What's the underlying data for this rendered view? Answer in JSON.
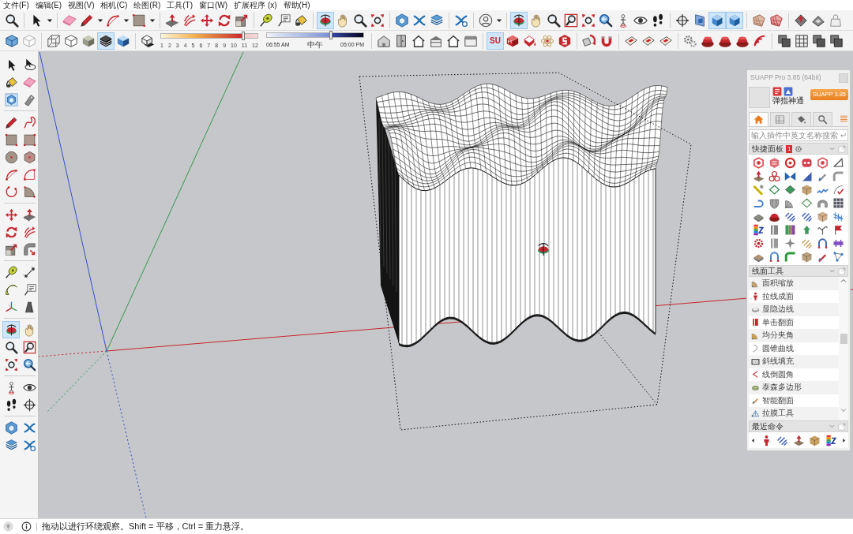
{
  "menu_bar": [
    "文件(F)",
    "编辑(E)",
    "视图(V)",
    "相机(C)",
    "绘图(R)",
    "工具(T)",
    "窗口(W)",
    "扩展程序 (x)",
    "帮助(H)"
  ],
  "toolbar_row_1": [
    [
      {
        "selected": false
      }
    ],
    [
      {
        "selected": false
      }
    ],
    [
      {
        "selected": false
      },
      {
        "selected": false
      },
      {
        "selected": false
      },
      {
        "selected": false
      }
    ],
    [
      {
        "selected": false
      },
      {
        "selected": false
      },
      {
        "selected": false
      },
      {
        "selected": false
      },
      {
        "selected": false
      }
    ],
    [
      {
        "selected": false
      },
      {
        "selected": false
      },
      {
        "selected": false
      }
    ],
    [
      {
        "selected": true
      },
      {
        "selected": false
      },
      {
        "selected": false
      },
      {
        "selected": false
      }
    ],
    [
      {
        "selected": false
      },
      {
        "selected": false
      },
      {
        "selected": false
      }
    ],
    [
      {
        "selected": false
      }
    ],
    [
      {
        "selected": false
      }
    ],
    [
      {
        "selected": true
      },
      {
        "selected": false
      },
      {
        "selected": false
      },
      {
        "selected": false
      },
      {
        "selected": false
      },
      {
        "selected": false
      },
      {
        "selected": false
      },
      {
        "selected": false
      },
      {
        "selected": false
      }
    ],
    [
      {
        "selected": false
      },
      {
        "selected": false
      },
      {
        "selected": true
      },
      {
        "selected": true
      }
    ],
    [
      {
        "selected": false
      },
      {
        "selected": false
      }
    ],
    [
      {
        "selected": false
      },
      {
        "selected": false
      },
      {
        "selected": false
      }
    ]
  ],
  "toolbar_row_2": {
    "style_groups": [
      [
        {
          "selected": false
        },
        {
          "selected": false
        }
      ],
      [
        {
          "selected": false
        },
        {
          "selected": false
        },
        {
          "selected": false
        },
        {
          "selected": true
        },
        {
          "selected": false
        }
      ]
    ],
    "shadow_toggle": {
      "selected": false
    },
    "date_slider": {
      "level": 0.85,
      "ticks": [
        "1",
        "2",
        "3",
        "4",
        "5",
        "6",
        "7",
        "8",
        "9",
        "10",
        "11",
        "12"
      ]
    },
    "time_slider": {
      "level": 0.66,
      "start_label": "06:55 AM",
      "middle_label": "中午",
      "end_label": "05:00 PM"
    },
    "plugin_groups": [
      [
        {
          "selected": false
        },
        {
          "selected": false
        },
        {
          "selected": false
        },
        {
          "selected": false
        },
        {
          "selected": false
        },
        {
          "selected": false
        }
      ],
      [
        {
          "selected": true,
          "label": "SU"
        },
        {
          "selected": false
        },
        {
          "selected": false
        },
        {
          "selected": false
        },
        {
          "selected": false
        }
      ],
      [
        {
          "selected": false
        },
        {
          "selected": false
        }
      ],
      [
        {
          "selected": false
        },
        {
          "selected": false
        },
        {
          "selected": false
        }
      ],
      [
        {
          "selected": false
        },
        {
          "selected": false
        },
        {
          "selected": false
        },
        {
          "selected": false
        },
        {
          "selected": false
        }
      ],
      [
        {
          "selected": false
        },
        {
          "selected": false
        },
        {
          "selected": false
        },
        {
          "selected": false
        }
      ]
    ]
  },
  "left_toolbar": [
    [
      {
        "selected": false
      },
      {
        "selected": false
      },
      {
        "selected": false
      },
      {
        "selected": false
      },
      {
        "selected": false
      },
      {
        "selected": false
      }
    ],
    [
      {
        "selected": false
      },
      {
        "selected": false
      },
      {
        "selected": false
      },
      {
        "selected": false
      },
      {
        "selected": false
      },
      {
        "selected": false
      },
      {
        "selected": false
      },
      {
        "selected": false
      },
      {
        "selected": false
      },
      {
        "selected": false
      }
    ],
    [
      {
        "selected": false
      },
      {
        "selected": false
      },
      {
        "selected": false
      },
      {
        "selected": false
      },
      {
        "selected": false
      },
      {
        "selected": false
      }
    ],
    [
      {
        "selected": false
      },
      {
        "selected": false
      },
      {
        "selected": false
      },
      {
        "selected": false
      },
      {
        "selected": false
      },
      {
        "selected": false
      }
    ],
    [
      {
        "selected": true
      },
      {
        "selected": false
      },
      {
        "selected": false
      },
      {
        "selected": false
      },
      {
        "selected": false
      },
      {
        "selected": false
      }
    ],
    [
      {
        "selected": false
      },
      {
        "selected": false
      },
      {
        "selected": false
      },
      {
        "selected": false
      }
    ],
    [
      {
        "selected": false
      },
      {
        "selected": false
      },
      {
        "selected": false
      },
      {
        "selected": false
      }
    ]
  ],
  "suapp_panel": {
    "title": "SUAPP Pro 3.85 (64bit)",
    "user_name": "弹指神通",
    "version_button": "SUAPP 3.85",
    "tabs": [
      {
        "selected": true
      },
      {
        "selected": false
      },
      {
        "selected": false
      },
      {
        "selected": false
      }
    ],
    "search": {
      "placeholder": "输入插件中英文名称搜索"
    },
    "quick_panel": {
      "title": "快捷面板",
      "badge": "1"
    },
    "line_tools": {
      "title": "线面工具",
      "items": [
        "面积缩放",
        "拉线成面",
        "显隐边线",
        "单击翻面",
        "均分夹角",
        "圆锥曲线",
        "斜线填充",
        "线倒圆角",
        "泰森多边形",
        "智能翻面",
        "拉膜工具"
      ]
    },
    "recent_commands": {
      "title": "最近命令"
    }
  },
  "status_bar": {
    "message": "拖动以进行环绕观察。Shift = 平移，Ctrl = 重力悬浮。"
  }
}
